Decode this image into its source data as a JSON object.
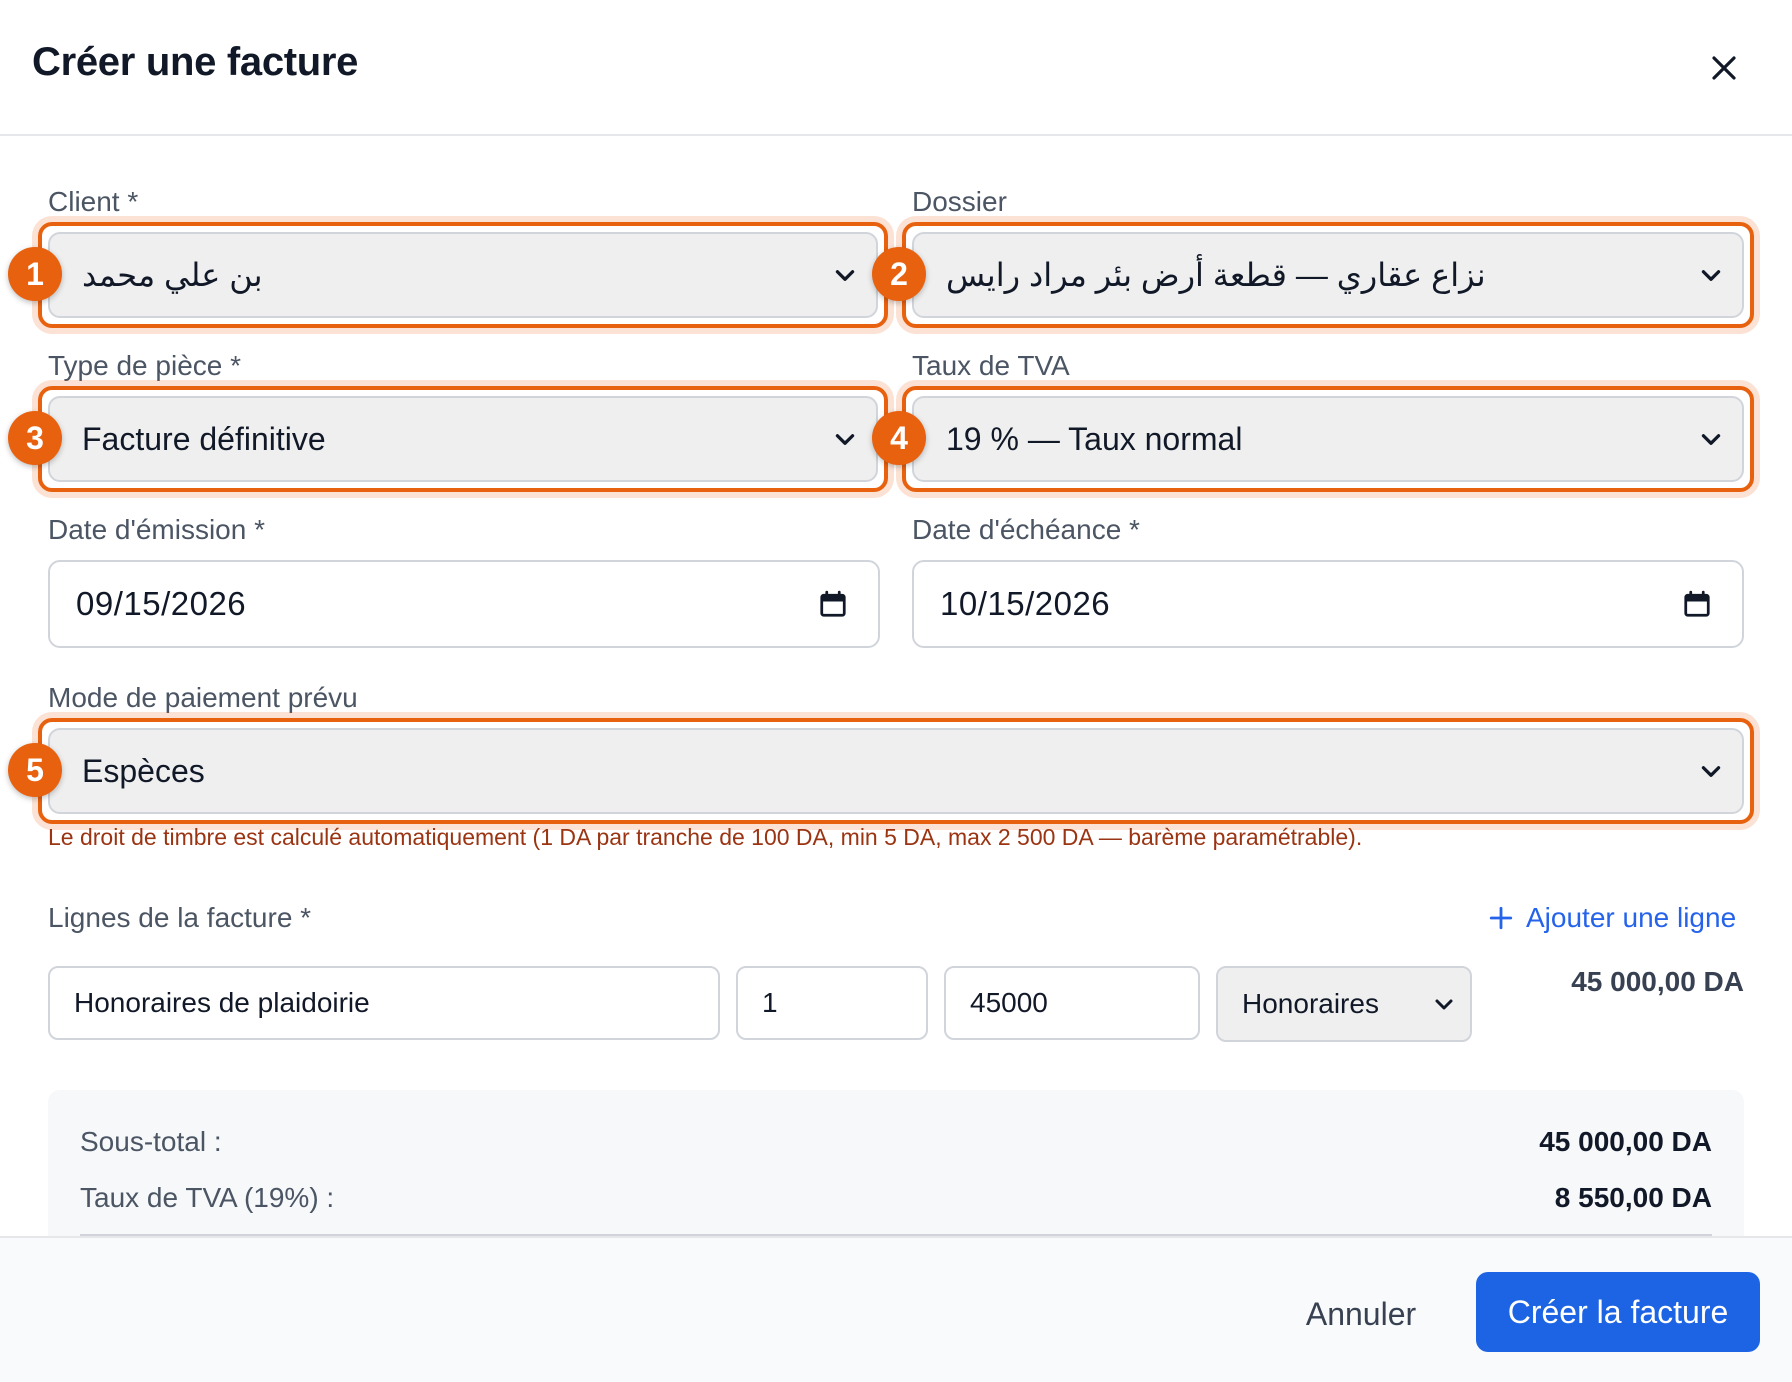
{
  "dialog": {
    "title": "Créer une facture",
    "close_icon": "close-icon"
  },
  "fields": {
    "client": {
      "label": "Client *",
      "value": "بن علي محمد",
      "badge": "1"
    },
    "dossier": {
      "label": "Dossier",
      "value": "نزاع عقاري — قطعة أرض بئر مراد رايس",
      "badge": "2"
    },
    "type_piece": {
      "label": "Type de pièce *",
      "value": "Facture définitive",
      "badge": "3"
    },
    "taux_tva": {
      "label": "Taux de TVA",
      "value": "19 % — Taux normal",
      "badge": "4"
    },
    "date_emission": {
      "label": "Date d'émission *",
      "value": "09/15/2026",
      "icon": "calendar-icon"
    },
    "date_echeance": {
      "label": "Date d'échéance *",
      "value": "10/15/2026",
      "icon": "calendar-icon"
    },
    "mode_paiement": {
      "label": "Mode de paiement prévu",
      "value": "Espèces",
      "badge": "5"
    },
    "hint": "Le droit de timbre est calculé automatiquement (1 DA par tranche de 100 DA, min 5 DA, max 2 500 DA — barème paramétrable)."
  },
  "lines": {
    "label": "Lignes de la facture *",
    "add_label": "Ajouter une ligne",
    "add_icon": "plus-icon",
    "rows": [
      {
        "description": "Honoraires de plaidoirie",
        "quantity": "1",
        "unit_price": "45000",
        "category": "Honoraires",
        "total": "45 000,00 DA"
      }
    ]
  },
  "summary": {
    "subtotal_label": "Sous-total :",
    "subtotal_value": "45 000,00 DA",
    "tva_label": "Taux de TVA (19%) :",
    "tva_value": "8 550,00 DA"
  },
  "footer": {
    "cancel_label": "Annuler",
    "submit_label": "Créer la facture"
  },
  "colors": {
    "highlight": "#e8610f",
    "primary": "#1d64e4",
    "link": "#2563eb",
    "hint": "#9a3412"
  }
}
